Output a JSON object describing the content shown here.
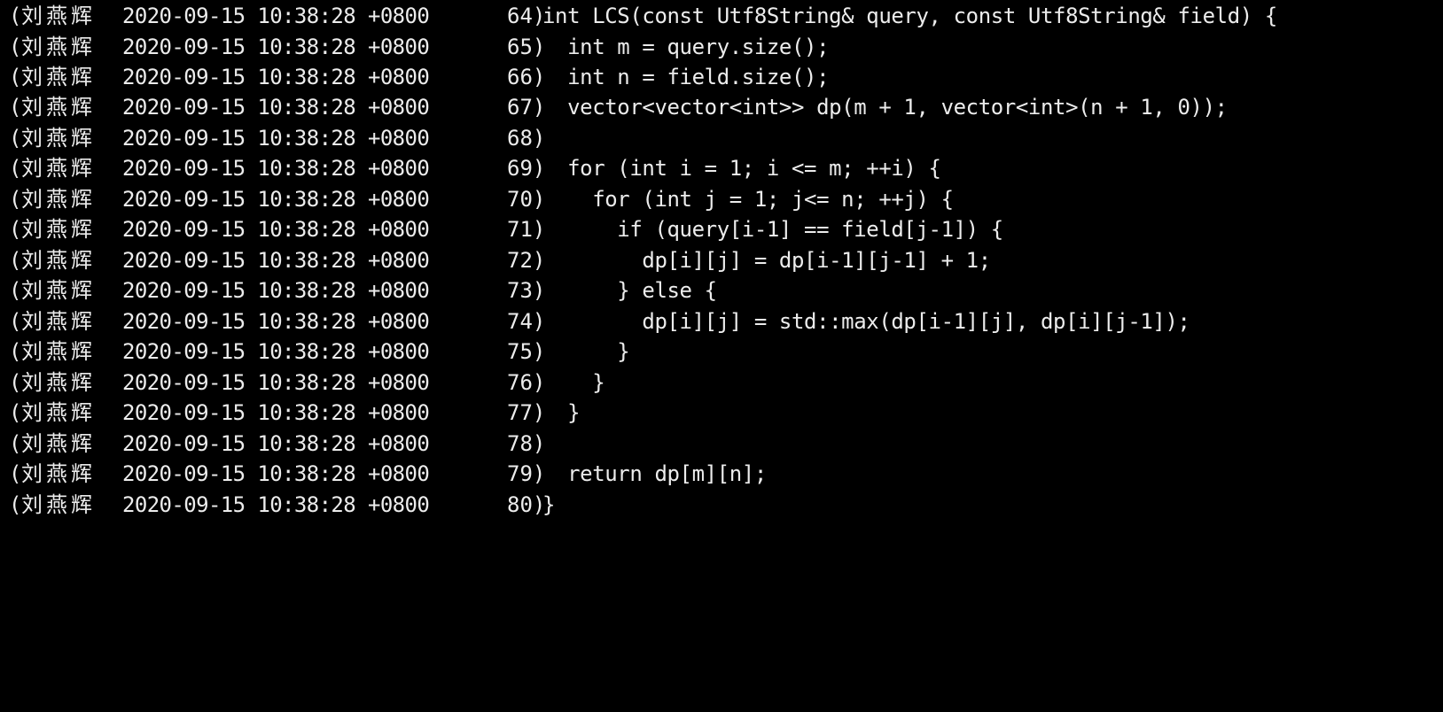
{
  "terminal": {
    "background": "#000000",
    "foreground": "#ececec",
    "lines": [
      {
        "prefix": "(",
        "author": "刘燕辉",
        "timestamp": "2020-09-15 10:38:28 +0800",
        "lineno": "64)",
        "code": "int LCS(const Utf8String& query, const Utf8String& field) {"
      },
      {
        "prefix": "(",
        "author": "刘燕辉",
        "timestamp": "2020-09-15 10:38:28 +0800",
        "lineno": "65)",
        "code": "  int m = query.size();"
      },
      {
        "prefix": "(",
        "author": "刘燕辉",
        "timestamp": "2020-09-15 10:38:28 +0800",
        "lineno": "66)",
        "code": "  int n = field.size();"
      },
      {
        "prefix": "(",
        "author": "刘燕辉",
        "timestamp": "2020-09-15 10:38:28 +0800",
        "lineno": "67)",
        "code": "  vector<vector<int>> dp(m + 1, vector<int>(n + 1, 0));"
      },
      {
        "prefix": "(",
        "author": "刘燕辉",
        "timestamp": "2020-09-15 10:38:28 +0800",
        "lineno": "68)",
        "code": ""
      },
      {
        "prefix": "(",
        "author": "刘燕辉",
        "timestamp": "2020-09-15 10:38:28 +0800",
        "lineno": "69)",
        "code": "  for (int i = 1; i <= m; ++i) {"
      },
      {
        "prefix": "(",
        "author": "刘燕辉",
        "timestamp": "2020-09-15 10:38:28 +0800",
        "lineno": "70)",
        "code": "    for (int j = 1; j<= n; ++j) {"
      },
      {
        "prefix": "(",
        "author": "刘燕辉",
        "timestamp": "2020-09-15 10:38:28 +0800",
        "lineno": "71)",
        "code": "      if (query[i-1] == field[j-1]) {"
      },
      {
        "prefix": "(",
        "author": "刘燕辉",
        "timestamp": "2020-09-15 10:38:28 +0800",
        "lineno": "72)",
        "code": "        dp[i][j] = dp[i-1][j-1] + 1;"
      },
      {
        "prefix": "(",
        "author": "刘燕辉",
        "timestamp": "2020-09-15 10:38:28 +0800",
        "lineno": "73)",
        "code": "      } else {"
      },
      {
        "prefix": "(",
        "author": "刘燕辉",
        "timestamp": "2020-09-15 10:38:28 +0800",
        "lineno": "74)",
        "code": "        dp[i][j] = std::max(dp[i-1][j], dp[i][j-1]);"
      },
      {
        "prefix": "(",
        "author": "刘燕辉",
        "timestamp": "2020-09-15 10:38:28 +0800",
        "lineno": "75)",
        "code": "      }"
      },
      {
        "prefix": "(",
        "author": "刘燕辉",
        "timestamp": "2020-09-15 10:38:28 +0800",
        "lineno": "76)",
        "code": "    }"
      },
      {
        "prefix": "(",
        "author": "刘燕辉",
        "timestamp": "2020-09-15 10:38:28 +0800",
        "lineno": "77)",
        "code": "  }"
      },
      {
        "prefix": "(",
        "author": "刘燕辉",
        "timestamp": "2020-09-15 10:38:28 +0800",
        "lineno": "78)",
        "code": ""
      },
      {
        "prefix": "(",
        "author": "刘燕辉",
        "timestamp": "2020-09-15 10:38:28 +0800",
        "lineno": "79)",
        "code": "  return dp[m][n];"
      },
      {
        "prefix": "(",
        "author": "刘燕辉",
        "timestamp": "2020-09-15 10:38:28 +0800",
        "lineno": "80)",
        "code": "}"
      }
    ]
  }
}
